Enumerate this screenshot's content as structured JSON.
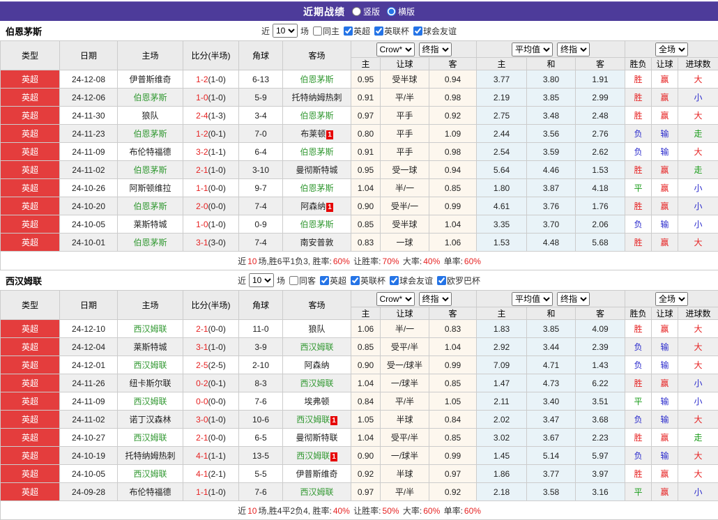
{
  "topbar": {
    "title": "近期战绩",
    "radios": [
      {
        "label": "竖版",
        "checked": false
      },
      {
        "label": "横版",
        "checked": true
      }
    ]
  },
  "filter_labels": {
    "near": "近",
    "games": "场"
  },
  "table_header": {
    "left_cols": [
      "类型",
      "日期",
      "主场",
      "比分(半场)",
      "角球",
      "客场"
    ],
    "group1_selects": [
      "Crow*",
      "终指"
    ],
    "group1_cols": [
      "主",
      "让球",
      "客"
    ],
    "group2_selects": [
      "平均值",
      "终指"
    ],
    "group2_cols": [
      "主",
      "和",
      "客"
    ],
    "group3_selects": [
      "全场"
    ],
    "group3_cols": [
      "胜负",
      "让球",
      "进球数"
    ]
  },
  "colors": {
    "topbar_purple": "#4d3b9a",
    "league_red_bg": "#e43d3d",
    "team_green": "#339933",
    "score_red": "#e62222",
    "win_red": "#e62222",
    "lose_blue": "#2929cc",
    "draw_green": "#1a9c1a",
    "crow_col_bg": "#fdf7ee",
    "avg_col_bg": "#e9f3f8"
  },
  "result_color_map": {
    "胜": "red",
    "负": "blue",
    "平": "green",
    "赢": "red",
    "输": "blue",
    "走": "green",
    "大": "red",
    "小": "blue"
  },
  "sections": [
    {
      "team": "伯恩茅斯",
      "near_value": "10",
      "same_label": "同主",
      "same_checked": false,
      "leagues": [
        {
          "label": "英超",
          "checked": true
        },
        {
          "label": "英联杯",
          "checked": true
        },
        {
          "label": "球会友谊",
          "checked": true
        }
      ],
      "rows": [
        {
          "league": "英超",
          "date": "24-12-08",
          "home": "伊普斯维奇",
          "home_team": false,
          "home_badge": "",
          "score": "1-2",
          "half": "(1-0)",
          "corners": "6-13",
          "away": "伯恩茅斯",
          "away_team": true,
          "away_badge": "",
          "c_home": "0.95",
          "c_hcp": "受半球",
          "c_away": "0.94",
          "a_home": "3.77",
          "a_draw": "3.80",
          "a_away": "1.91",
          "r_wl": "胜",
          "r_hcp": "赢",
          "r_goal": "大"
        },
        {
          "league": "英超",
          "date": "24-12-06",
          "home": "伯恩茅斯",
          "home_team": true,
          "home_badge": "",
          "score": "1-0",
          "half": "(1-0)",
          "corners": "5-9",
          "away": "托特纳姆热刺",
          "away_team": false,
          "away_badge": "",
          "c_home": "0.91",
          "c_hcp": "平/半",
          "c_away": "0.98",
          "a_home": "2.19",
          "a_draw": "3.85",
          "a_away": "2.99",
          "r_wl": "胜",
          "r_hcp": "赢",
          "r_goal": "小"
        },
        {
          "league": "英超",
          "date": "24-11-30",
          "home": "狼队",
          "home_team": false,
          "home_badge": "",
          "score": "2-4",
          "half": "(1-3)",
          "corners": "3-4",
          "away": "伯恩茅斯",
          "away_team": true,
          "away_badge": "",
          "c_home": "0.97",
          "c_hcp": "平手",
          "c_away": "0.92",
          "a_home": "2.75",
          "a_draw": "3.48",
          "a_away": "2.48",
          "r_wl": "胜",
          "r_hcp": "赢",
          "r_goal": "大"
        },
        {
          "league": "英超",
          "date": "24-11-23",
          "home": "伯恩茅斯",
          "home_team": true,
          "home_badge": "",
          "score": "1-2",
          "half": "(0-1)",
          "corners": "7-0",
          "away": "布莱顿",
          "away_team": false,
          "away_badge": "1",
          "c_home": "0.80",
          "c_hcp": "平手",
          "c_away": "1.09",
          "a_home": "2.44",
          "a_draw": "3.56",
          "a_away": "2.76",
          "r_wl": "负",
          "r_hcp": "输",
          "r_goal": "走"
        },
        {
          "league": "英超",
          "date": "24-11-09",
          "home": "布伦特福德",
          "home_team": false,
          "home_badge": "",
          "score": "3-2",
          "half": "(1-1)",
          "corners": "6-4",
          "away": "伯恩茅斯",
          "away_team": true,
          "away_badge": "",
          "c_home": "0.91",
          "c_hcp": "平手",
          "c_away": "0.98",
          "a_home": "2.54",
          "a_draw": "3.59",
          "a_away": "2.62",
          "r_wl": "负",
          "r_hcp": "输",
          "r_goal": "大"
        },
        {
          "league": "英超",
          "date": "24-11-02",
          "home": "伯恩茅斯",
          "home_team": true,
          "home_badge": "",
          "score": "2-1",
          "half": "(1-0)",
          "corners": "3-10",
          "away": "曼彻斯特城",
          "away_team": false,
          "away_badge": "",
          "c_home": "0.95",
          "c_hcp": "受一球",
          "c_away": "0.94",
          "a_home": "5.64",
          "a_draw": "4.46",
          "a_away": "1.53",
          "r_wl": "胜",
          "r_hcp": "赢",
          "r_goal": "走"
        },
        {
          "league": "英超",
          "date": "24-10-26",
          "home": "阿斯顿维拉",
          "home_team": false,
          "home_badge": "",
          "score": "1-1",
          "half": "(0-0)",
          "corners": "9-7",
          "away": "伯恩茅斯",
          "away_team": true,
          "away_badge": "",
          "c_home": "1.04",
          "c_hcp": "半/一",
          "c_away": "0.85",
          "a_home": "1.80",
          "a_draw": "3.87",
          "a_away": "4.18",
          "r_wl": "平",
          "r_hcp": "赢",
          "r_goal": "小"
        },
        {
          "league": "英超",
          "date": "24-10-20",
          "home": "伯恩茅斯",
          "home_team": true,
          "home_badge": "",
          "score": "2-0",
          "half": "(0-0)",
          "corners": "7-4",
          "away": "阿森纳",
          "away_team": false,
          "away_badge": "1",
          "c_home": "0.90",
          "c_hcp": "受半/一",
          "c_away": "0.99",
          "a_home": "4.61",
          "a_draw": "3.76",
          "a_away": "1.76",
          "r_wl": "胜",
          "r_hcp": "赢",
          "r_goal": "小"
        },
        {
          "league": "英超",
          "date": "24-10-05",
          "home": "莱斯特城",
          "home_team": false,
          "home_badge": "",
          "score": "1-0",
          "half": "(1-0)",
          "corners": "0-9",
          "away": "伯恩茅斯",
          "away_team": true,
          "away_badge": "",
          "c_home": "0.85",
          "c_hcp": "受半球",
          "c_away": "1.04",
          "a_home": "3.35",
          "a_draw": "3.70",
          "a_away": "2.06",
          "r_wl": "负",
          "r_hcp": "输",
          "r_goal": "小"
        },
        {
          "league": "英超",
          "date": "24-10-01",
          "home": "伯恩茅斯",
          "home_team": true,
          "home_badge": "",
          "score": "3-1",
          "half": "(3-0)",
          "corners": "7-4",
          "away": "南安普敦",
          "away_team": false,
          "away_badge": "",
          "c_home": "0.83",
          "c_hcp": "一球",
          "c_away": "1.06",
          "a_home": "1.53",
          "a_draw": "4.48",
          "a_away": "5.68",
          "r_wl": "胜",
          "r_hcp": "赢",
          "r_goal": "大"
        }
      ],
      "summary": [
        {
          "t": "近",
          "red": false
        },
        {
          "t": "10",
          "red": true
        },
        {
          "t": "场,胜6平1负3, 胜率:",
          "red": false
        },
        {
          "t": "60%",
          "red": true
        },
        {
          "t": " 让胜率:",
          "red": false
        },
        {
          "t": "70%",
          "red": true
        },
        {
          "t": " 大率:",
          "red": false
        },
        {
          "t": "40%",
          "red": true
        },
        {
          "t": " 单率:",
          "red": false
        },
        {
          "t": "60%",
          "red": true
        }
      ]
    },
    {
      "team": "西汉姆联",
      "near_value": "10",
      "same_label": "同客",
      "same_checked": false,
      "leagues": [
        {
          "label": "英超",
          "checked": true
        },
        {
          "label": "英联杯",
          "checked": true
        },
        {
          "label": "球会友谊",
          "checked": true
        },
        {
          "label": "欧罗巴杯",
          "checked": true
        }
      ],
      "rows": [
        {
          "league": "英超",
          "date": "24-12-10",
          "home": "西汉姆联",
          "home_team": true,
          "home_badge": "",
          "score": "2-1",
          "half": "(0-0)",
          "corners": "11-0",
          "away": "狼队",
          "away_team": false,
          "away_badge": "",
          "c_home": "1.06",
          "c_hcp": "半/一",
          "c_away": "0.83",
          "a_home": "1.83",
          "a_draw": "3.85",
          "a_away": "4.09",
          "r_wl": "胜",
          "r_hcp": "赢",
          "r_goal": "大"
        },
        {
          "league": "英超",
          "date": "24-12-04",
          "home": "莱斯特城",
          "home_team": false,
          "home_badge": "",
          "score": "3-1",
          "half": "(1-0)",
          "corners": "3-9",
          "away": "西汉姆联",
          "away_team": true,
          "away_badge": "",
          "c_home": "0.85",
          "c_hcp": "受平/半",
          "c_away": "1.04",
          "a_home": "2.92",
          "a_draw": "3.44",
          "a_away": "2.39",
          "r_wl": "负",
          "r_hcp": "输",
          "r_goal": "大"
        },
        {
          "league": "英超",
          "date": "24-12-01",
          "home": "西汉姆联",
          "home_team": true,
          "home_badge": "",
          "score": "2-5",
          "half": "(2-5)",
          "corners": "2-10",
          "away": "阿森纳",
          "away_team": false,
          "away_badge": "",
          "c_home": "0.90",
          "c_hcp": "受一/球半",
          "c_away": "0.99",
          "a_home": "7.09",
          "a_draw": "4.71",
          "a_away": "1.43",
          "r_wl": "负",
          "r_hcp": "输",
          "r_goal": "大"
        },
        {
          "league": "英超",
          "date": "24-11-26",
          "home": "纽卡斯尔联",
          "home_team": false,
          "home_badge": "",
          "score": "0-2",
          "half": "(0-1)",
          "corners": "8-3",
          "away": "西汉姆联",
          "away_team": true,
          "away_badge": "",
          "c_home": "1.04",
          "c_hcp": "一/球半",
          "c_away": "0.85",
          "a_home": "1.47",
          "a_draw": "4.73",
          "a_away": "6.22",
          "r_wl": "胜",
          "r_hcp": "赢",
          "r_goal": "小"
        },
        {
          "league": "英超",
          "date": "24-11-09",
          "home": "西汉姆联",
          "home_team": true,
          "home_badge": "",
          "score": "0-0",
          "half": "(0-0)",
          "corners": "7-6",
          "away": "埃弗顿",
          "away_team": false,
          "away_badge": "",
          "c_home": "0.84",
          "c_hcp": "平/半",
          "c_away": "1.05",
          "a_home": "2.11",
          "a_draw": "3.40",
          "a_away": "3.51",
          "r_wl": "平",
          "r_hcp": "输",
          "r_goal": "小"
        },
        {
          "league": "英超",
          "date": "24-11-02",
          "home": "诺丁汉森林",
          "home_team": false,
          "home_badge": "",
          "score": "3-0",
          "half": "(1-0)",
          "corners": "10-6",
          "away": "西汉姆联",
          "away_team": true,
          "away_badge": "1",
          "c_home": "1.05",
          "c_hcp": "半球",
          "c_away": "0.84",
          "a_home": "2.02",
          "a_draw": "3.47",
          "a_away": "3.68",
          "r_wl": "负",
          "r_hcp": "输",
          "r_goal": "大"
        },
        {
          "league": "英超",
          "date": "24-10-27",
          "home": "西汉姆联",
          "home_team": true,
          "home_badge": "",
          "score": "2-1",
          "half": "(0-0)",
          "corners": "6-5",
          "away": "曼彻斯特联",
          "away_team": false,
          "away_badge": "",
          "c_home": "1.04",
          "c_hcp": "受平/半",
          "c_away": "0.85",
          "a_home": "3.02",
          "a_draw": "3.67",
          "a_away": "2.23",
          "r_wl": "胜",
          "r_hcp": "赢",
          "r_goal": "走"
        },
        {
          "league": "英超",
          "date": "24-10-19",
          "home": "托特纳姆热刺",
          "home_team": false,
          "home_badge": "",
          "score": "4-1",
          "half": "(1-1)",
          "corners": "13-5",
          "away": "西汉姆联",
          "away_team": true,
          "away_badge": "1",
          "c_home": "0.90",
          "c_hcp": "一/球半",
          "c_away": "0.99",
          "a_home": "1.45",
          "a_draw": "5.14",
          "a_away": "5.97",
          "r_wl": "负",
          "r_hcp": "输",
          "r_goal": "大"
        },
        {
          "league": "英超",
          "date": "24-10-05",
          "home": "西汉姆联",
          "home_team": true,
          "home_badge": "",
          "score": "4-1",
          "half": "(2-1)",
          "corners": "5-5",
          "away": "伊普斯维奇",
          "away_team": false,
          "away_badge": "",
          "c_home": "0.92",
          "c_hcp": "半球",
          "c_away": "0.97",
          "a_home": "1.86",
          "a_draw": "3.77",
          "a_away": "3.97",
          "r_wl": "胜",
          "r_hcp": "赢",
          "r_goal": "大"
        },
        {
          "league": "英超",
          "date": "24-09-28",
          "home": "布伦特福德",
          "home_team": false,
          "home_badge": "",
          "score": "1-1",
          "half": "(1-0)",
          "corners": "7-6",
          "away": "西汉姆联",
          "away_team": true,
          "away_badge": "",
          "c_home": "0.97",
          "c_hcp": "平/半",
          "c_away": "0.92",
          "a_home": "2.18",
          "a_draw": "3.58",
          "a_away": "3.16",
          "r_wl": "平",
          "r_hcp": "赢",
          "r_goal": "小"
        }
      ],
      "summary": [
        {
          "t": "近",
          "red": false
        },
        {
          "t": "10",
          "red": true
        },
        {
          "t": "场,胜4平2负4, 胜率:",
          "red": false
        },
        {
          "t": "40%",
          "red": true
        },
        {
          "t": " 让胜率:",
          "red": false
        },
        {
          "t": "50%",
          "red": true
        },
        {
          "t": " 大率:",
          "red": false
        },
        {
          "t": "60%",
          "red": true
        },
        {
          "t": " 单率:",
          "red": false
        },
        {
          "t": "60%",
          "red": true
        }
      ]
    }
  ]
}
